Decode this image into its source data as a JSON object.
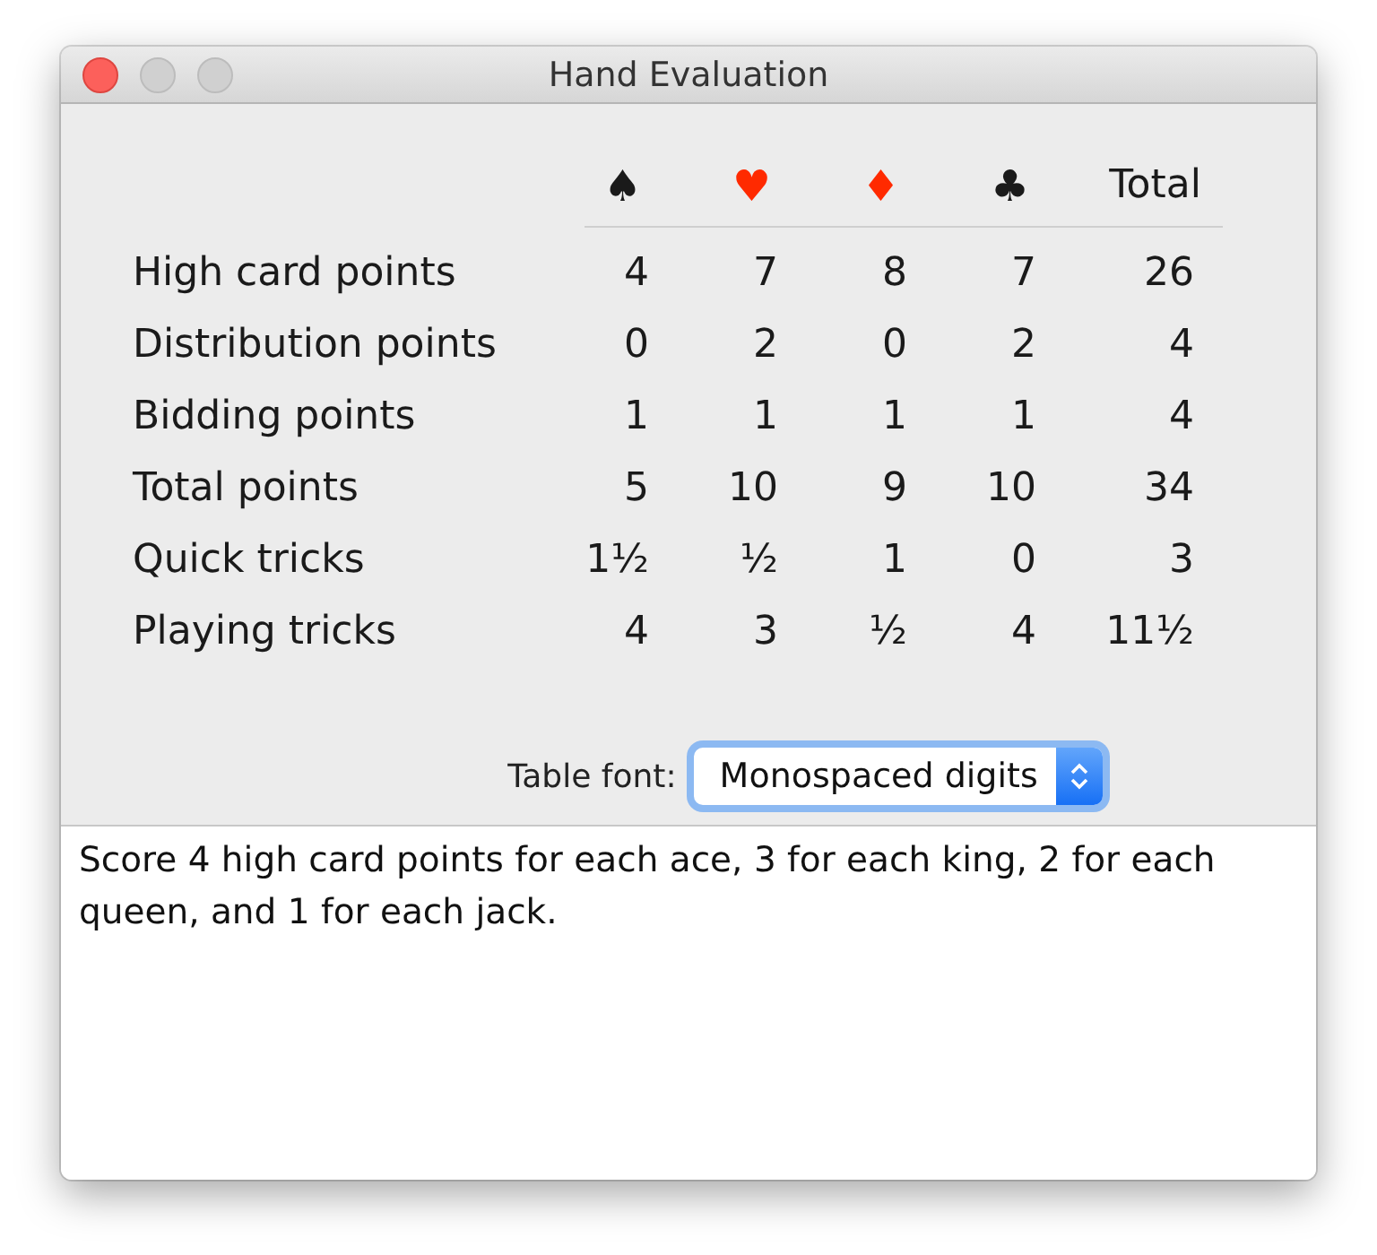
{
  "window": {
    "title": "Hand Evaluation"
  },
  "table": {
    "columns": [
      {
        "label": "♠",
        "color": "#1a1a1a"
      },
      {
        "label": "♥",
        "color": "#ff2a00"
      },
      {
        "label": "♦",
        "color": "#ff2a00"
      },
      {
        "label": "♣",
        "color": "#1a1a1a"
      },
      {
        "label": "Total",
        "color": "#1a1a1a"
      }
    ],
    "rows": [
      {
        "label": "High card points",
        "cells": [
          "4",
          "7",
          "8",
          "7",
          "26"
        ]
      },
      {
        "label": "Distribution points",
        "cells": [
          "0",
          "2",
          "0",
          "2",
          "4"
        ]
      },
      {
        "label": "Bidding points",
        "cells": [
          "1",
          "1",
          "1",
          "1",
          "4"
        ]
      },
      {
        "label": "Total points",
        "cells": [
          "5",
          "10",
          "9",
          "10",
          "34"
        ]
      },
      {
        "label": "Quick tricks",
        "cells": [
          "1½",
          "½",
          "1",
          "0",
          "3"
        ]
      },
      {
        "label": "Playing tricks",
        "cells": [
          "4",
          "3",
          "½",
          "4",
          "11½"
        ]
      }
    ]
  },
  "table_font": {
    "label": "Table font:",
    "value": "Monospaced digits",
    "focused": true
  },
  "description": "Score 4 high card points for each ace, 3 for each king, 2 for each queen, and 1 for each jack."
}
